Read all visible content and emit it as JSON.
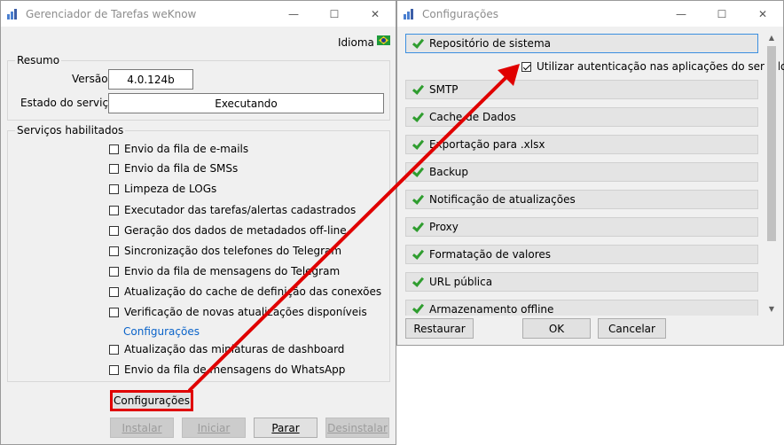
{
  "left_window": {
    "title": "Gerenciador de Tarefas weKnow",
    "language_label": "Idioma",
    "summary": {
      "group_label": "Resumo",
      "version_label": "Versão",
      "version_value": "4.0.124b",
      "service_state_label": "Estado do serviço",
      "service_state_value": "Executando"
    },
    "services": {
      "group_label": "Serviços habilitados",
      "items": [
        "Envio da fila de e-mails",
        "Envio da fila de SMSs",
        "Limpeza de LOGs",
        "Executador das tarefas/alertas cadastrados",
        "Geração dos dados de metadados off-line",
        "Sincronização dos telefones do Telegram",
        "Envio da fila de mensagens do Telegram",
        "Atualização do cache de definição das conexões",
        "Verificação de novas atualizações disponíveis"
      ],
      "config_link": "Configurações",
      "items_after": [
        "Atualização das miniaturas de dashboard",
        "Envio da fila de mensagens do WhatsApp"
      ]
    },
    "buttons": {
      "config": "Configurações",
      "install": "Instalar",
      "start": "Iniciar",
      "stop": "Parar",
      "uninstall": "Desinstalar"
    }
  },
  "right_window": {
    "title": "Configurações",
    "sections": [
      "Repositório de sistema",
      "SMTP",
      "Cache de Dados",
      "Exportação para .xlsx",
      "Backup",
      "Notificação de atualizações",
      "Proxy",
      "Formatação de valores",
      "URL pública",
      "Armazenamento offline"
    ],
    "option_label": "Utilizar autenticação nas aplicações do servidor",
    "option_checked": true,
    "buttons": {
      "restore": "Restaurar",
      "ok": "OK",
      "cancel": "Cancelar"
    }
  },
  "colors": {
    "annotation": "#e00000",
    "link": "#0a63c9",
    "check": "#2f9d2f"
  }
}
